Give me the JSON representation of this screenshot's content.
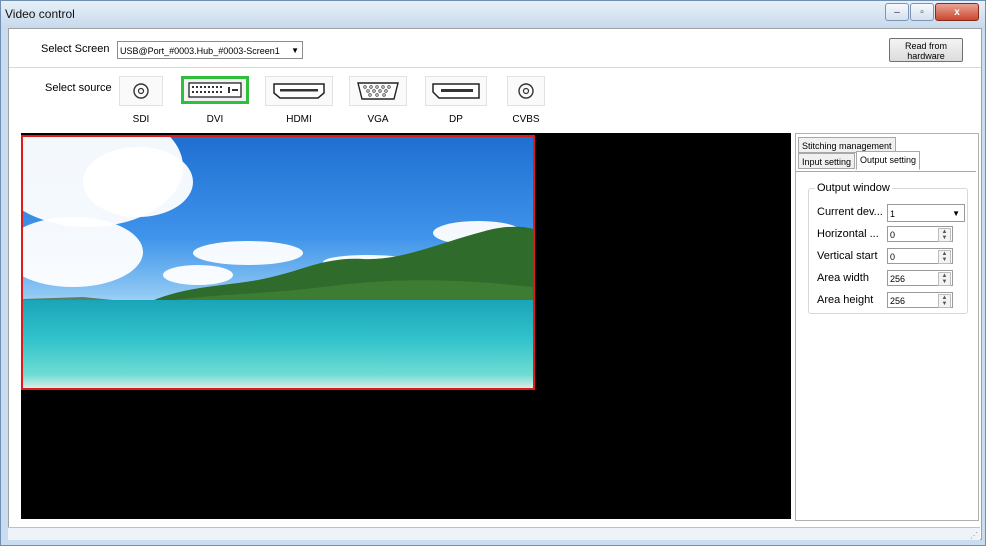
{
  "window": {
    "title": "Video control"
  },
  "caption_buttons": {
    "minimize": "–",
    "maximize": "▫",
    "close": "x"
  },
  "screen": {
    "label": "Select Screen",
    "value": "USB@Port_#0003.Hub_#0003-Screen1",
    "read_button": "Read from hardware"
  },
  "source": {
    "label": "Select source",
    "items": [
      {
        "name": "SDI",
        "icon": "sdi-connector-icon"
      },
      {
        "name": "DVI",
        "icon": "dvi-connector-icon",
        "selected": true
      },
      {
        "name": "HDMI",
        "icon": "hdmi-connector-icon"
      },
      {
        "name": "VGA",
        "icon": "vga-connector-icon"
      },
      {
        "name": "DP",
        "icon": "displayport-connector-icon"
      },
      {
        "name": "CVBS",
        "icon": "cvbs-connector-icon"
      }
    ]
  },
  "panel": {
    "tabs": {
      "stitching": "Stitching management",
      "input": "Input setting",
      "output": "Output setting"
    },
    "output_window": {
      "title": "Output window",
      "current_device_label": "Current dev...",
      "current_device_value": "1",
      "horizontal_label": "Horizontal ...",
      "horizontal_value": "0",
      "vertical_label": "Vertical start",
      "vertical_value": "0",
      "width_label": "Area width",
      "width_value": "256",
      "height_label": "Area height",
      "height_value": "256"
    }
  },
  "colors": {
    "selected_source": "#2fbf3a",
    "active_window_border": "#e01a1a",
    "preview_bg": "#000000"
  }
}
